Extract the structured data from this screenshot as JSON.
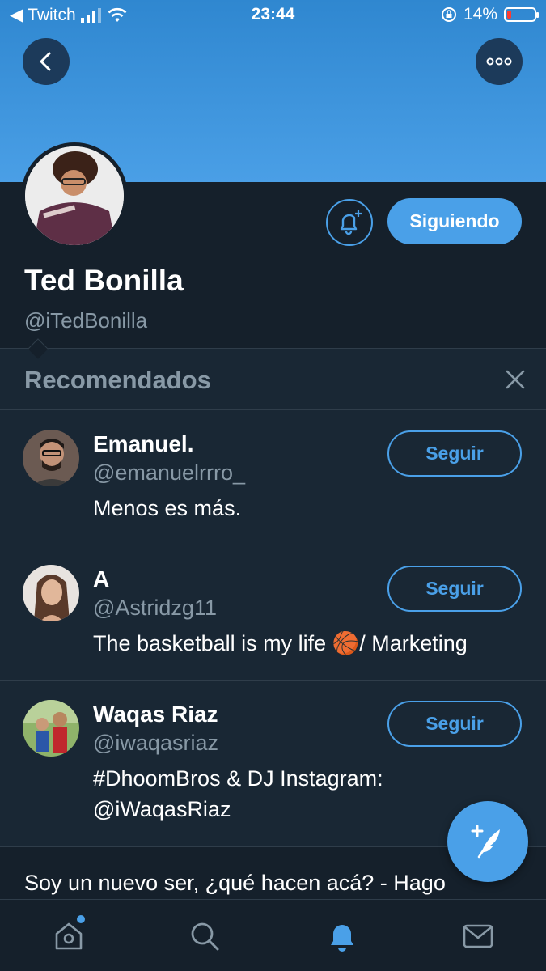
{
  "status_bar": {
    "carrier": "Twitch",
    "time": "23:44",
    "battery": "14%"
  },
  "profile": {
    "display_name": "Ted Bonilla",
    "handle": "@iTedBonilla",
    "following_label": "Siguiendo"
  },
  "recommended": {
    "title": "Recomendados",
    "items": [
      {
        "name": "Emanuel.",
        "handle": "@emanuelrrro_",
        "bio": "Menos es más.",
        "follow_label": "Seguir"
      },
      {
        "name": "A",
        "handle": "@Astridzg11",
        "bio": "The basketball is my life 🏀/ Marketing",
        "follow_label": "Seguir"
      },
      {
        "name": "Waqas Riaz",
        "handle": "@iwaqasriaz",
        "bio": "#DhoomBros & DJ Instagram: @iWaqasRiaz",
        "follow_label": "Seguir"
      }
    ]
  },
  "tweet_preview": "Soy un nuevo ser, ¿qué hacen acá? - Hago",
  "colors": {
    "accent": "#4aa0e8",
    "background": "#15202b",
    "section_background": "#192734",
    "secondary_text": "#8899a6"
  },
  "icons": [
    "back-arrow-icon",
    "more-options-icon",
    "notification-bell-plus-icon",
    "close-icon",
    "compose-tweet-icon",
    "home-icon",
    "search-icon",
    "notifications-icon",
    "messages-icon"
  ]
}
